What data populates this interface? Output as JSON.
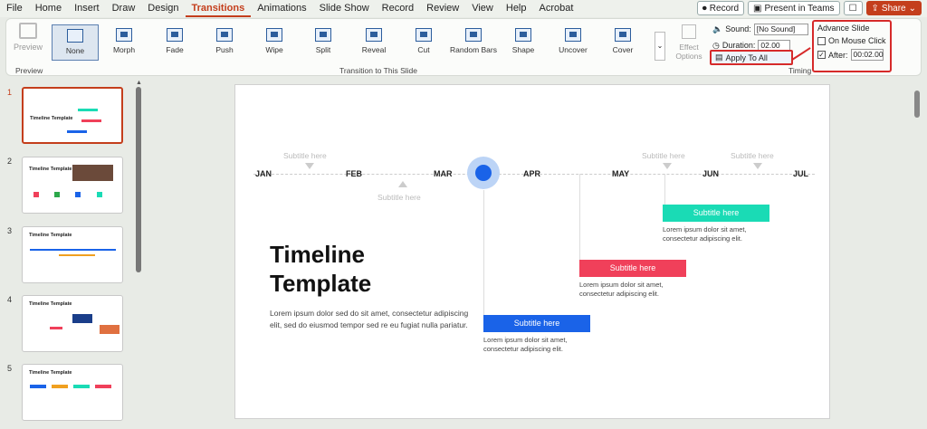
{
  "menu": {
    "items": [
      "File",
      "Home",
      "Insert",
      "Draw",
      "Design",
      "Transitions",
      "Animations",
      "Slide Show",
      "Record",
      "Review",
      "View",
      "Help",
      "Acrobat"
    ],
    "active": "Transitions"
  },
  "top_buttons": {
    "record": "Record",
    "present_teams": "Present in Teams",
    "share": "Share"
  },
  "ribbon": {
    "preview_label": "Preview",
    "preview_group": "Preview",
    "transitions": [
      "None",
      "Morph",
      "Fade",
      "Push",
      "Wipe",
      "Split",
      "Reveal",
      "Cut",
      "Random Bars",
      "Shape",
      "Uncover",
      "Cover"
    ],
    "selected_transition": "None",
    "effect_options": "Effect Options",
    "group_label": "Transition to This Slide",
    "timing": {
      "sound_label": "Sound:",
      "sound_value": "[No Sound]",
      "duration_label": "Duration:",
      "duration_value": "02.00",
      "apply_all": "Apply To All",
      "group_label": "Timing"
    },
    "advance": {
      "title": "Advance Slide",
      "on_click_label": "On Mouse Click",
      "on_click_checked": false,
      "after_label": "After:",
      "after_checked": true,
      "after_value": "00:02.00"
    }
  },
  "thumbnails": [
    {
      "number": "1",
      "title": "Timeline Template",
      "selected": true
    },
    {
      "number": "2",
      "title": "Timeline Template",
      "selected": false
    },
    {
      "number": "3",
      "title": "Timeline Template",
      "selected": false
    },
    {
      "number": "4",
      "title": "Timeline Template",
      "selected": false
    },
    {
      "number": "5",
      "title": "Timeline Template",
      "selected": false
    }
  ],
  "slide": {
    "months": [
      "JAN",
      "FEB",
      "MAR",
      "APR",
      "MAY",
      "JUN",
      "JUL"
    ],
    "subtitle_top_1": "Subtitle here",
    "subtitle_bottom": "Subtitle here",
    "subtitle_top_2": "Subtitle here",
    "subtitle_top_3": "Subtitle here",
    "title_line1": "Timeline",
    "title_line2": "Template",
    "body": "Lorem ipsum dolor sed do sit amet, consectetur adipiscing elit, sed do eiusmod tempor sed re eu fugiat nulla pariatur.",
    "bars": [
      {
        "label": "Subtitle here",
        "color": "#1adbb5",
        "text_line1": "Lorem ipsum dolor sit amet,",
        "text_line2": "consectetur adipiscing elit."
      },
      {
        "label": "Subtitle here",
        "color": "#f0405a",
        "text_line1": "Lorem ipsum dolor sit amet,",
        "text_line2": "consectetur adipiscing elit."
      },
      {
        "label": "Subtitle here",
        "color": "#1a63e8",
        "text_line1": "Lorem ipsum dolor sit amet,",
        "text_line2": "consectetur adipiscing elit."
      }
    ]
  }
}
